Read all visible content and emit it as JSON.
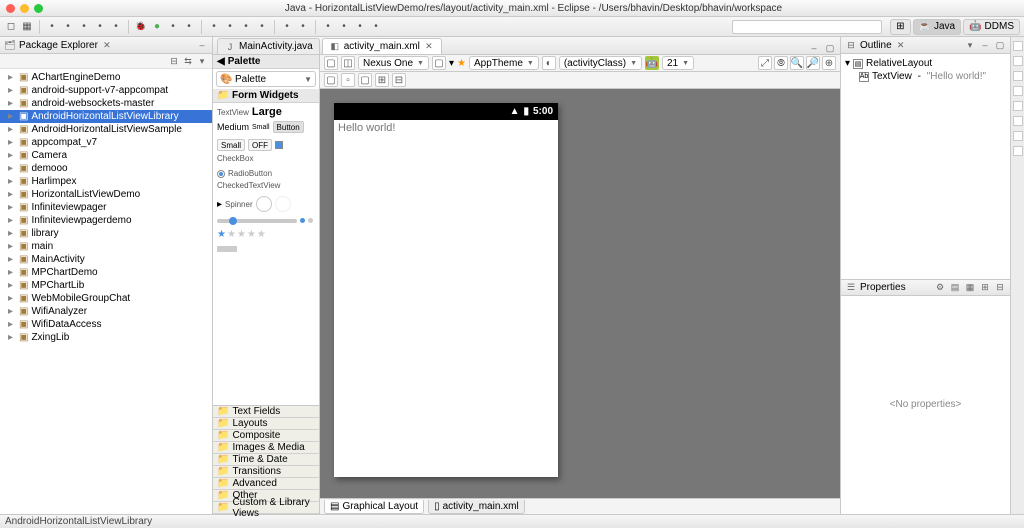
{
  "window": {
    "title": "Java - HorizontalListViewDemo/res/layout/activity_main.xml - Eclipse - /Users/bhavin/Desktop/bhavin/workspace"
  },
  "perspectives": {
    "open": "⊞",
    "java": "Java",
    "ddms": "DDMS"
  },
  "package_explorer": {
    "title": "Package Explorer",
    "items": [
      {
        "label": "AChartEngineDemo",
        "exp": true
      },
      {
        "label": "android-support-v7-appcompat",
        "exp": true
      },
      {
        "label": "android-websockets-master",
        "exp": true
      },
      {
        "label": "AndroidHorizontalListViewLibrary",
        "exp": true,
        "selected": true
      },
      {
        "label": "AndroidHorizontalListViewSample",
        "exp": true
      },
      {
        "label": "appcompat_v7",
        "exp": true
      },
      {
        "label": "Camera",
        "exp": true
      },
      {
        "label": "demooo",
        "exp": true
      },
      {
        "label": "Harlimpex",
        "exp": true
      },
      {
        "label": "HorizontalListViewDemo",
        "exp": true
      },
      {
        "label": "Infiniteviewpager",
        "exp": true
      },
      {
        "label": "Infiniteviewpagerdemo",
        "exp": true
      },
      {
        "label": "library",
        "exp": true
      },
      {
        "label": "main",
        "exp": true
      },
      {
        "label": "MainActivity",
        "exp": true
      },
      {
        "label": "MPChartDemo",
        "exp": true
      },
      {
        "label": "MPChartLib",
        "exp": true
      },
      {
        "label": "WebMobileGroupChat",
        "exp": true
      },
      {
        "label": "WifiAnalyzer",
        "exp": true
      },
      {
        "label": "WifiDataAccess",
        "exp": true
      },
      {
        "label": "ZxingLib",
        "exp": true
      }
    ]
  },
  "editor": {
    "tabs": [
      {
        "label": "MainActivity.java",
        "active": false
      },
      {
        "label": "activity_main.xml",
        "active": true
      }
    ]
  },
  "palette": {
    "title": "Palette",
    "dropdown": "Palette",
    "form_widgets": "Form Widgets",
    "textview_label": "TextView",
    "sizes": {
      "large": "Large",
      "medium": "Medium",
      "small": "Small"
    },
    "button": "Button",
    "small_btn": "Small",
    "off": "OFF",
    "checkbox": "CheckBox",
    "radiobutton": "RadioButton",
    "checked_textview": "CheckedTextView",
    "spinner": "Spinner",
    "categories": [
      "Text Fields",
      "Layouts",
      "Composite",
      "Images & Media",
      "Time & Date",
      "Transitions",
      "Advanced",
      "Other",
      "Custom & Library Views"
    ]
  },
  "canvas": {
    "device": "Nexus One",
    "theme": "AppTheme",
    "activity": "(activityClass)",
    "api": "21",
    "time": "5:00",
    "hello": "Hello world!"
  },
  "bottom_tabs": {
    "graphical": "Graphical Layout",
    "xml": "activity_main.xml"
  },
  "outline": {
    "title": "Outline",
    "root": "RelativeLayout",
    "child": "TextView",
    "child_text": "\"Hello world!\""
  },
  "properties": {
    "title": "Properties",
    "empty": "<No properties>"
  },
  "statusline": "AndroidHorizontalListViewLibrary"
}
